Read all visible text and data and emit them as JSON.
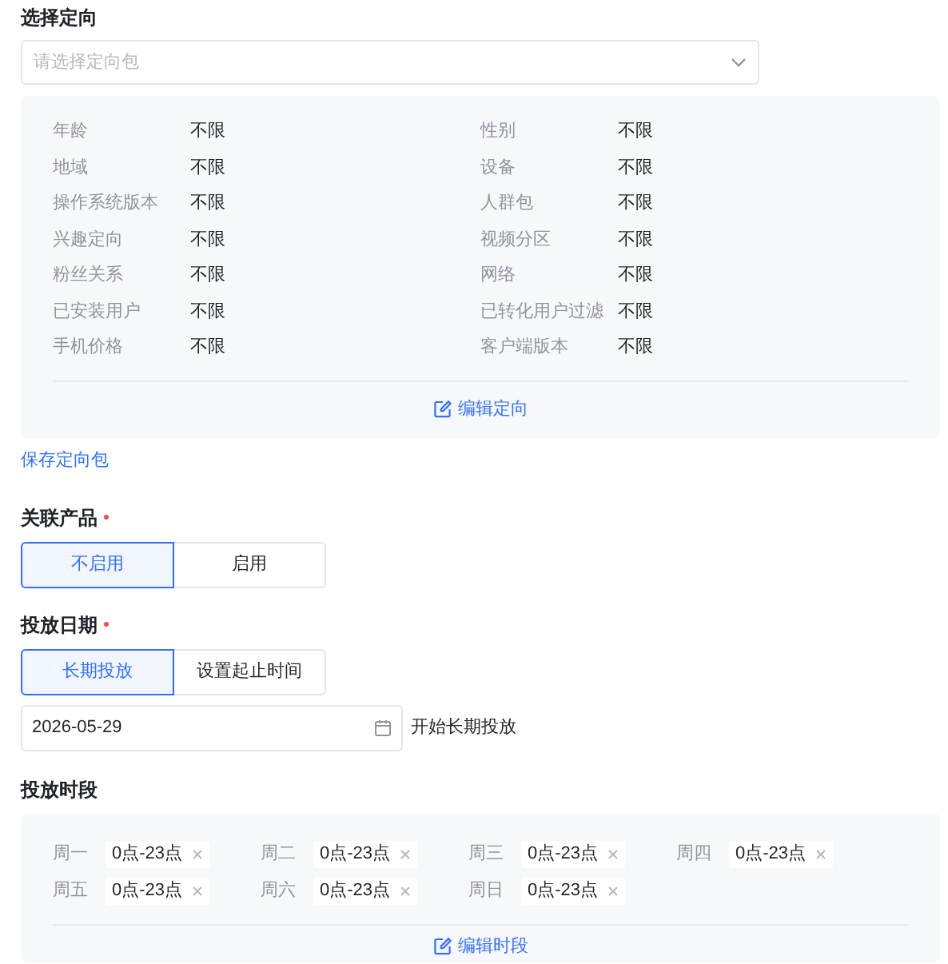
{
  "targeting": {
    "title": "选择定向",
    "select": {
      "placeholder": "请选择定向包"
    },
    "items": [
      {
        "label": "年龄",
        "value": "不限"
      },
      {
        "label": "性别",
        "value": "不限"
      },
      {
        "label": "地域",
        "value": "不限"
      },
      {
        "label": "设备",
        "value": "不限"
      },
      {
        "label": "操作系统版本",
        "value": "不限"
      },
      {
        "label": "人群包",
        "value": "不限"
      },
      {
        "label": "兴趣定向",
        "value": "不限"
      },
      {
        "label": "视频分区",
        "value": "不限"
      },
      {
        "label": "粉丝关系",
        "value": "不限"
      },
      {
        "label": "网络",
        "value": "不限"
      },
      {
        "label": "已安装用户",
        "value": "不限"
      },
      {
        "label": "已转化用户过滤",
        "value": "不限"
      },
      {
        "label": "手机价格",
        "value": "不限"
      },
      {
        "label": "客户端版本",
        "value": "不限"
      }
    ],
    "edit_link": "编辑定向",
    "save_link": "保存定向包"
  },
  "product": {
    "label": "关联产品",
    "required": true,
    "options": [
      {
        "label": "不启用",
        "selected": true
      },
      {
        "label": "启用",
        "selected": false
      }
    ]
  },
  "date": {
    "label": "投放日期",
    "required": true,
    "options": [
      {
        "label": "长期投放",
        "selected": true
      },
      {
        "label": "设置起止时间",
        "selected": false
      }
    ],
    "value": "2026-05-29",
    "note": "开始长期投放"
  },
  "schedule": {
    "label": "投放时段",
    "days": [
      {
        "day": "周一",
        "range": "0点-23点"
      },
      {
        "day": "周二",
        "range": "0点-23点"
      },
      {
        "day": "周三",
        "range": "0点-23点"
      },
      {
        "day": "周四",
        "range": "0点-23点"
      },
      {
        "day": "周五",
        "range": "0点-23点"
      },
      {
        "day": "周六",
        "range": "0点-23点"
      },
      {
        "day": "周日",
        "range": "0点-23点"
      }
    ],
    "edit_link": "编辑时段"
  }
}
